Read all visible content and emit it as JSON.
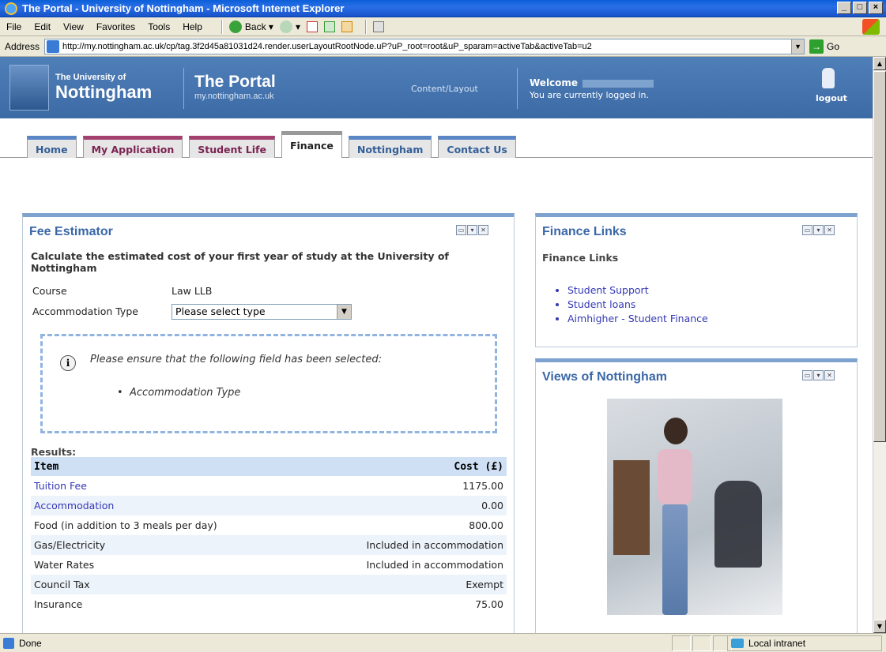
{
  "window": {
    "title": "The Portal - University of Nottingham - Microsoft Internet Explorer"
  },
  "menu": {
    "items": [
      "File",
      "Edit",
      "View",
      "Favorites",
      "Tools",
      "Help"
    ],
    "back_label": "Back"
  },
  "address": {
    "label": "Address",
    "url": "http://my.nottingham.ac.uk/cp/tag.3f2d45a81031d24.render.userLayoutRootNode.uP?uP_root=root&uP_sparam=activeTab&activeTab=u2",
    "go_label": "Go"
  },
  "header": {
    "uni_small": "The University of",
    "uni_big": "Nottingham",
    "portal_title": "The Portal",
    "portal_sub": "my.nottingham.ac.uk",
    "content_layout": "Content/Layout",
    "welcome": "Welcome",
    "logged_in": "You are currently logged in.",
    "logout": "logout"
  },
  "tabs": [
    {
      "label": "Home"
    },
    {
      "label": "My Application"
    },
    {
      "label": "Student Life"
    },
    {
      "label": "Finance"
    },
    {
      "label": "Nottingham"
    },
    {
      "label": "Contact Us"
    }
  ],
  "fee": {
    "title": "Fee Estimator",
    "description": "Calculate the estimated cost of your first year of study at the University of Nottingham",
    "course_label": "Course",
    "course_value": "Law LLB",
    "accom_label": "Accommodation Type",
    "accom_selected": "Please select type",
    "warning": "Please ensure that the following field has been selected:",
    "warning_item": "Accommodation Type",
    "results_label": "Results:",
    "col_item": "Item",
    "col_cost": "Cost (£)",
    "rows": [
      {
        "item": "Tuition Fee",
        "cost": "1175.00"
      },
      {
        "item": "Accommodation",
        "cost": "0.00"
      },
      {
        "item": "Food (in addition to 3 meals per day)",
        "cost": "800.00"
      },
      {
        "item": "Gas/Electricity",
        "cost": "Included in accommodation"
      },
      {
        "item": "Water Rates",
        "cost": "Included in accommodation"
      },
      {
        "item": "Council Tax",
        "cost": "Exempt"
      },
      {
        "item": "Insurance",
        "cost": "75.00"
      }
    ]
  },
  "finance_links": {
    "title": "Finance Links",
    "subtitle": "Finance Links",
    "links": [
      "Student Support",
      "Student loans",
      "Aimhigher - Student Finance"
    ]
  },
  "views": {
    "title": "Views of Nottingham"
  },
  "status": {
    "text": "Done",
    "zone": "Local intranet"
  }
}
